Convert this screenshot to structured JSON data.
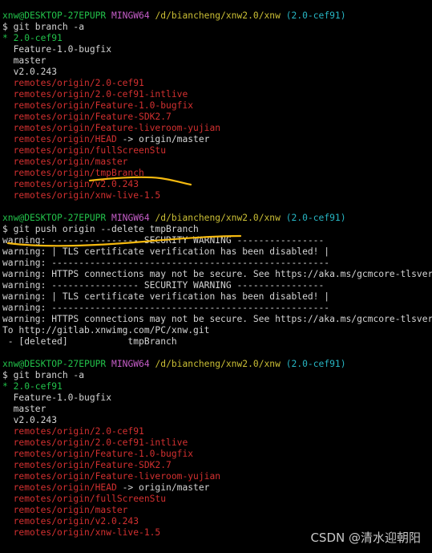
{
  "terminal": {
    "blocks": [
      {
        "prompt": {
          "user": "xnw@DESKTOP-27EPUPR",
          "system": "MINGW64",
          "path": "/d/biancheng/xnw2.0/xnw",
          "branch": "(2.0-cef91)"
        },
        "command": "$ git branch -a",
        "output": [
          {
            "text": "* 2.0-cef91",
            "kind": "current"
          },
          {
            "text": "  Feature-1.0-bugfix",
            "kind": "local"
          },
          {
            "text": "  master",
            "kind": "local"
          },
          {
            "text": "  v2.0.243",
            "kind": "local"
          },
          {
            "text": "  remotes/origin/2.0-cef91",
            "kind": "remote"
          },
          {
            "text": "  remotes/origin/2.0-cef91-intlive",
            "kind": "remote"
          },
          {
            "text": "  remotes/origin/Feature-1.0-bugfix",
            "kind": "remote"
          },
          {
            "text": "  remotes/origin/Feature-SDK2.7",
            "kind": "remote"
          },
          {
            "text": "  remotes/origin/Feature-liveroom-yujian",
            "kind": "remote"
          },
          {
            "text": "  remotes/origin/HEAD",
            "suffix": " -> origin/master",
            "kind": "remote"
          },
          {
            "text": "  remotes/origin/fullScreenStu",
            "kind": "remote"
          },
          {
            "text": "  remotes/origin/master",
            "kind": "remote"
          },
          {
            "text": "  remotes/origin/tmpBranch",
            "kind": "remote"
          },
          {
            "text": "  remotes/origin/v2.0.243",
            "kind": "remote"
          },
          {
            "text": "  remotes/origin/xnw-live-1.5",
            "kind": "remote"
          }
        ]
      },
      {
        "prompt": {
          "user": "xnw@DESKTOP-27EPUPR",
          "system": "MINGW64",
          "path": "/d/biancheng/xnw2.0/xnw",
          "branch": "(2.0-cef91)"
        },
        "command": "$ git push origin --delete tmpBranch",
        "output": [
          {
            "text": "warning: ---------------- SECURITY WARNING ----------------",
            "kind": "out"
          },
          {
            "text": "warning: | TLS certificate verification has been disabled! |",
            "kind": "out"
          },
          {
            "text": "warning: ---------------------------------------------------",
            "kind": "out"
          },
          {
            "text": "warning: HTTPS connections may not be secure. See https://aka.ms/gcmcore-tlsverify for more information.",
            "kind": "out"
          },
          {
            "text": "warning: ---------------- SECURITY WARNING ----------------",
            "kind": "out"
          },
          {
            "text": "warning: | TLS certificate verification has been disabled! |",
            "kind": "out"
          },
          {
            "text": "warning: ---------------------------------------------------",
            "kind": "out"
          },
          {
            "text": "warning: HTTPS connections may not be secure. See https://aka.ms/gcmcore-tlsverify for more information.",
            "kind": "out"
          },
          {
            "text": "To http://gitlab.xnwimg.com/PC/xnw.git",
            "kind": "out"
          },
          {
            "text": " - [deleted]           tmpBranch",
            "kind": "out"
          }
        ]
      },
      {
        "prompt": {
          "user": "xnw@DESKTOP-27EPUPR",
          "system": "MINGW64",
          "path": "/d/biancheng/xnw2.0/xnw",
          "branch": "(2.0-cef91)"
        },
        "command": "$ git branch -a",
        "output": [
          {
            "text": "* 2.0-cef91",
            "kind": "current"
          },
          {
            "text": "  Feature-1.0-bugfix",
            "kind": "local"
          },
          {
            "text": "  master",
            "kind": "local"
          },
          {
            "text": "  v2.0.243",
            "kind": "local"
          },
          {
            "text": "  remotes/origin/2.0-cef91",
            "kind": "remote"
          },
          {
            "text": "  remotes/origin/2.0-cef91-intlive",
            "kind": "remote"
          },
          {
            "text": "  remotes/origin/Feature-1.0-bugfix",
            "kind": "remote"
          },
          {
            "text": "  remotes/origin/Feature-SDK2.7",
            "kind": "remote"
          },
          {
            "text": "  remotes/origin/Feature-liveroom-yujian",
            "kind": "remote"
          },
          {
            "text": "  remotes/origin/HEAD",
            "suffix": " -> origin/master",
            "kind": "remote"
          },
          {
            "text": "  remotes/origin/fullScreenStu",
            "kind": "remote"
          },
          {
            "text": "  remotes/origin/master",
            "kind": "remote"
          },
          {
            "text": "  remotes/origin/v2.0.243",
            "kind": "remote"
          },
          {
            "text": "  remotes/origin/xnw-live-1.5",
            "kind": "remote"
          }
        ]
      }
    ]
  },
  "watermark": "CSDN @清水迎朝阳",
  "colors": {
    "background": "#000000",
    "user": "#22c14a",
    "system": "#c65ec9",
    "path": "#cbbf35",
    "branch": "#27b6c4",
    "remote": "#d33030",
    "text": "#d4d4d4",
    "highlight": "#f5b90f"
  }
}
